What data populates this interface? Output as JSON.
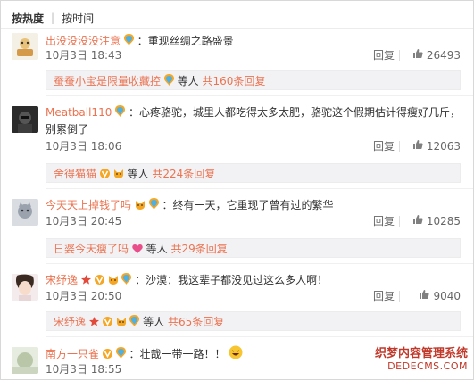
{
  "sort_tabs": {
    "hot": "按热度",
    "time": "按时间"
  },
  "comments": [
    {
      "user": "出没没没没注意",
      "text": "：重现丝绸之路盛景",
      "date": "10月3日 18:43",
      "reply_label": "回复",
      "likes": "26493",
      "replies": {
        "names": "蚕蚕小宝是限量收藏控",
        "etc": "等人",
        "total": "共160条回复"
      }
    },
    {
      "user": "Meatball110",
      "text": "：心疼骆驼，城里人都吃得太多太肥，骆驼这个假期估计得瘦好几斤，别累倒了",
      "date": "10月3日 18:06",
      "reply_label": "回复",
      "likes": "12063",
      "replies": {
        "names": "舍得猫猫",
        "etc": "等人",
        "total": "共224条回复"
      }
    },
    {
      "user": "今天天上掉钱了吗",
      "text": "：终有一天，它重现了曾有过的繁华",
      "date": "10月3日 20:45",
      "reply_label": "回复",
      "likes": "10285",
      "replies": {
        "names": "日婆今天瘦了吗",
        "etc": "等人",
        "total": "共29条回复"
      }
    },
    {
      "user": "宋纾逸",
      "text": "：沙漠：我这辈子都没见过这么多人啊！",
      "date": "10月3日 20:50",
      "reply_label": "回复",
      "likes": "9040",
      "replies": {
        "names": "宋纾逸",
        "etc": "等人",
        "total": "共65条回复"
      }
    },
    {
      "user": "南方一只雀",
      "text": "：壮哉一带一路！！",
      "date": "10月3日 18:55",
      "reply_label": "",
      "likes": ""
    }
  ],
  "watermark": {
    "line1": "织梦内容管理系统",
    "line2": "DEDECMS.COM"
  },
  "colors": {
    "username": "#eb7350",
    "reply_bg": "#f2f2f5"
  }
}
